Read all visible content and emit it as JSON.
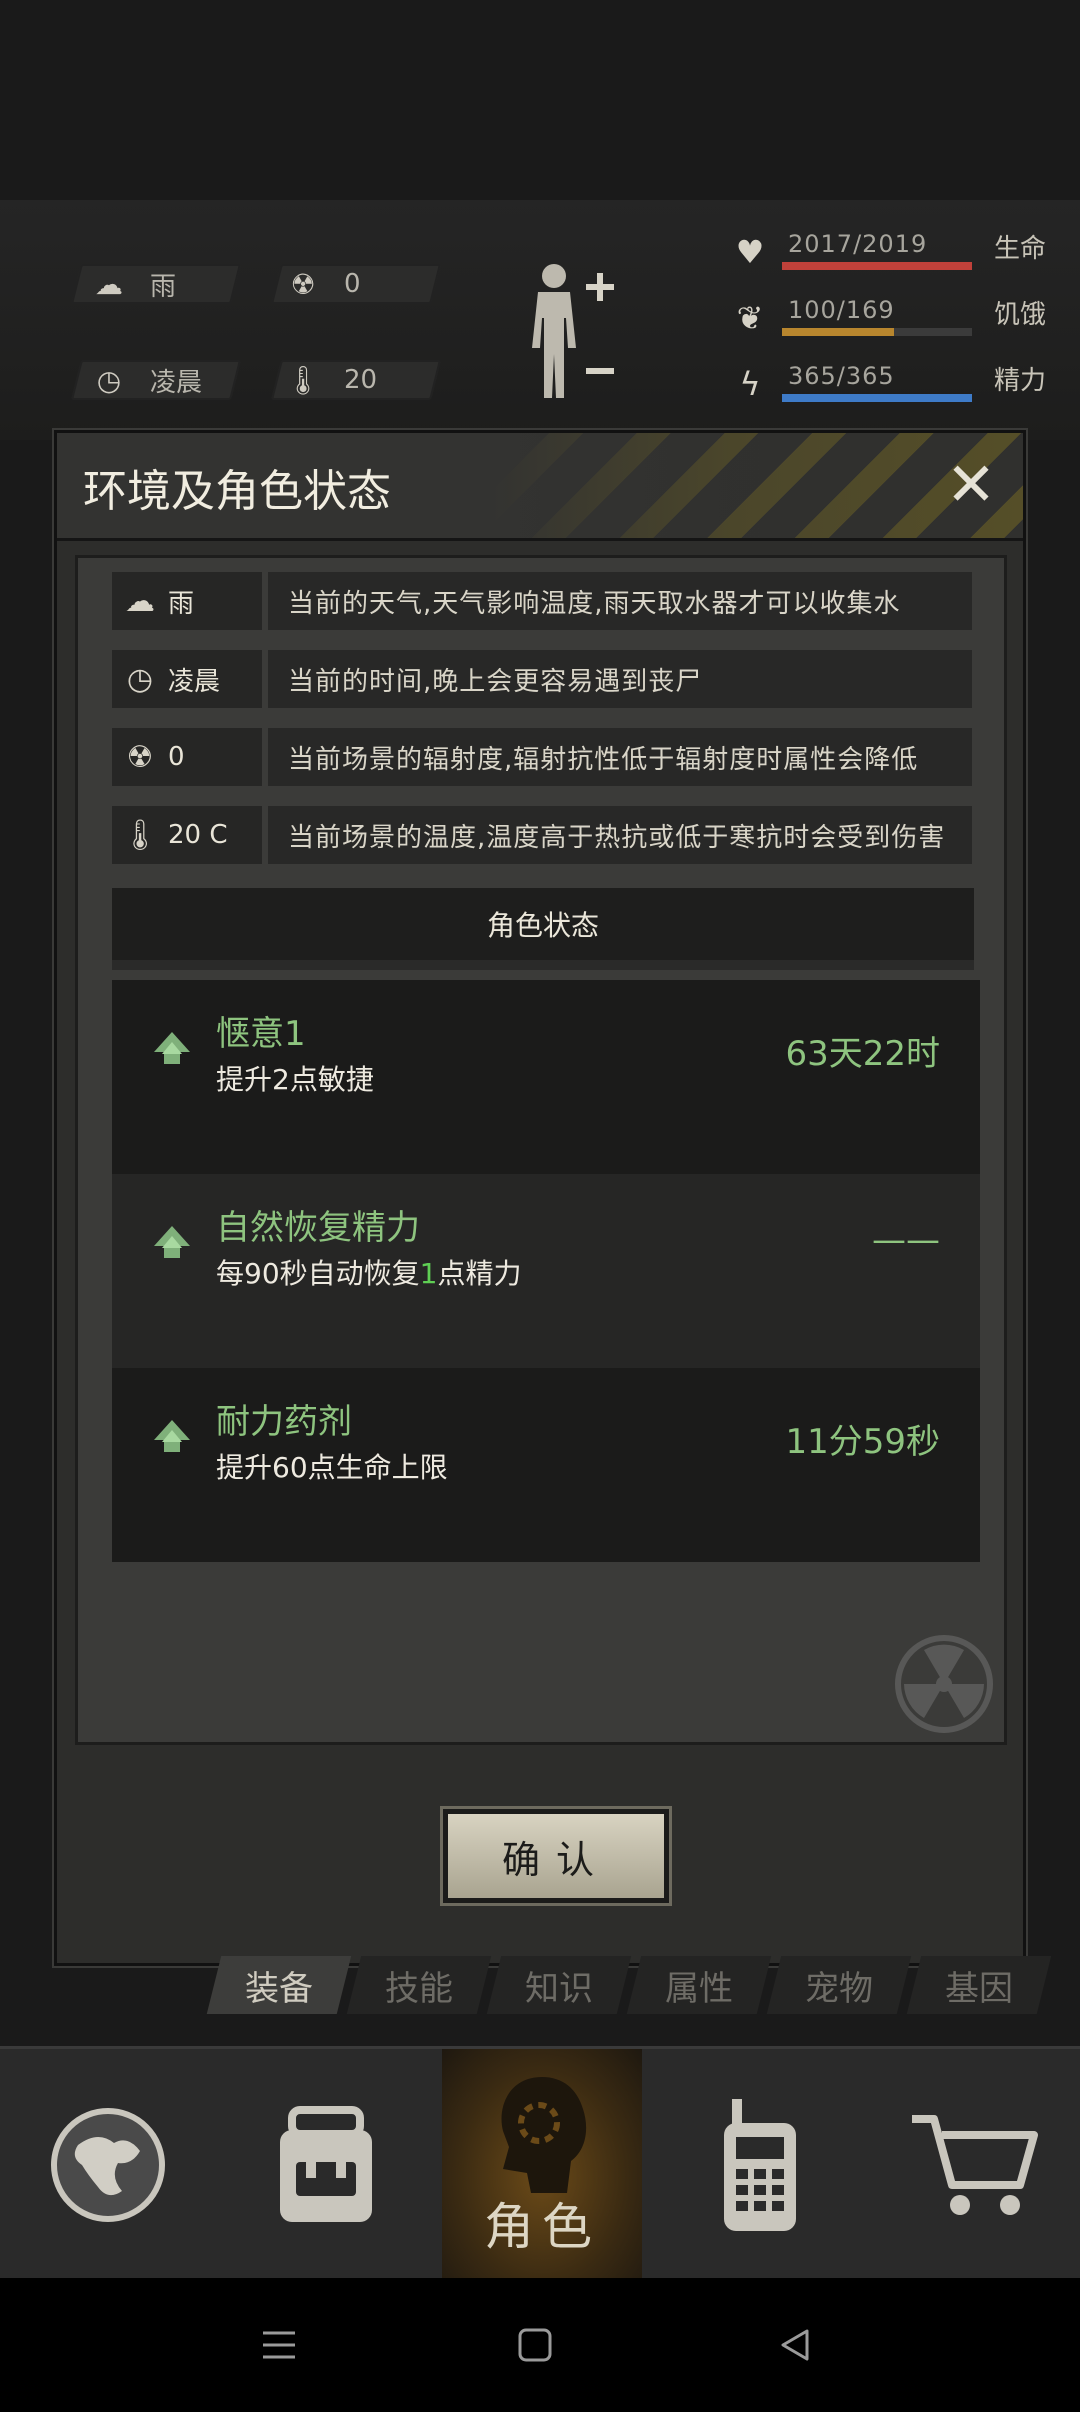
{
  "hud": {
    "weather": "雨",
    "radiation": "0",
    "time_of_day": "凌晨",
    "temperature": "20",
    "stats": [
      {
        "label": "生命",
        "value": "2017/2019",
        "fill": 0.999,
        "color": "#c0413a"
      },
      {
        "label": "饥饿",
        "value": "100/169",
        "fill": 0.59,
        "color": "#b8862e"
      },
      {
        "label": "精力",
        "value": "365/365",
        "fill": 1.0,
        "color": "#3e7bc8"
      }
    ]
  },
  "dialog": {
    "title": "环境及角色状态",
    "env_rows": [
      {
        "icon": "rain-cloud-icon",
        "value": "雨",
        "desc": "当前的天气,天气影响温度,雨天取水器才可以收集水"
      },
      {
        "icon": "clock-icon",
        "value": "凌晨",
        "desc": "当前的时间,晚上会更容易遇到丧尸"
      },
      {
        "icon": "radiation-icon",
        "value": "0",
        "desc": "当前场景的辐射度,辐射抗性低于辐射度时属性会降低"
      },
      {
        "icon": "thermometer-icon",
        "value": "20 C",
        "desc": "当前场景的温度,温度高于热抗或低于寒抗时会受到伤害"
      }
    ],
    "status_header": "角色状态",
    "status_items": [
      {
        "name": "惬意1",
        "desc": "提升2点敏捷",
        "time": "63天22时"
      },
      {
        "name": "自然恢复精力",
        "desc_prefix": "每90秒自动恢复",
        "desc_highlight": "1",
        "desc_suffix": "点精力",
        "time": "——"
      },
      {
        "name": "耐力药剂",
        "desc": "提升60点生命上限",
        "time": "11分59秒"
      }
    ],
    "confirm_label": "确认"
  },
  "subtabs": [
    "装备",
    "技能",
    "知识",
    "属性",
    "宠物",
    "基因"
  ],
  "nav": {
    "role_label": "角色"
  },
  "colors": {
    "accent_green": "#8ec47f",
    "highlight_green": "#5fcf54",
    "hazard_yellow": "#5b5326"
  }
}
